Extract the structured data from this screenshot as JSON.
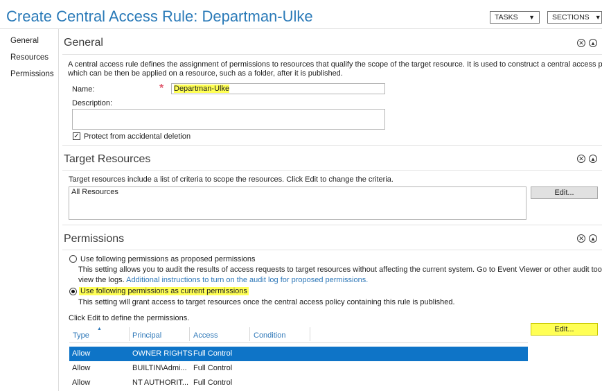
{
  "header": {
    "title": "Create Central Access Rule: Departman-Ulke",
    "tasks_label": "TASKS",
    "sections_label": "SECTIONS"
  },
  "nav": {
    "items": [
      {
        "label": "General"
      },
      {
        "label": "Resources"
      },
      {
        "label": "Permissions"
      }
    ]
  },
  "general": {
    "title": "General",
    "description_line1": "A central access rule defines the assignment of permissions to resources that qualify the scope of the target resource. It is used to construct a central access policy,",
    "description_line2": "which can be then be applied on a resource, such as a folder, after it is published.",
    "name_label": "Name:",
    "name_value": "Departman-Ulke",
    "required_marker": "*",
    "desc_label": "Description:",
    "desc_value": "",
    "protect_label": "Protect from accidental deletion",
    "protect_checked": true
  },
  "target": {
    "title": "Target Resources",
    "description": "Target resources include a list of criteria to scope the resources. Click Edit to change the criteria.",
    "criteria_value": "All Resources",
    "edit_label": "Edit..."
  },
  "permissions": {
    "title": "Permissions",
    "option_proposed": "Use following permissions as proposed permissions",
    "proposed_desc1": "This setting allows you to audit the results of access requests to target resources without affecting the current system. Go to Event Viewer or other audit tool to",
    "proposed_desc2_prefix": "view the logs.",
    "proposed_link": "Additional instructions to turn on the audit log for proposed permissions.",
    "option_current": "Use following permissions as current permissions",
    "current_desc": "This setting will grant access to target resources once the central access policy containing this rule is published.",
    "selected_option": "current",
    "click_edit_text": "Click Edit to define the permissions.",
    "edit_label": "Edit...",
    "columns": [
      "Type",
      "Principal",
      "Access",
      "Condition"
    ],
    "rows": [
      {
        "type": "Allow",
        "principal": "OWNER RIGHTS",
        "access": "Full Control",
        "condition": "",
        "selected": true
      },
      {
        "type": "Allow",
        "principal": "BUILTIN\\Admi...",
        "access": "Full Control",
        "condition": "",
        "selected": false
      },
      {
        "type": "Allow",
        "principal": "NT AUTHORIT...",
        "access": "Full Control",
        "condition": "",
        "selected": false
      }
    ]
  },
  "icons": {
    "close": "close-icon",
    "collapse": "chevron-up-icon",
    "dropdown": "chevron-down-icon"
  },
  "colors": {
    "title_blue": "#2a7ab8",
    "link_blue": "#2d77b8",
    "selection_blue": "#0e74c7",
    "highlight_yellow": "#ffff55",
    "required_red": "#e05a6e"
  }
}
